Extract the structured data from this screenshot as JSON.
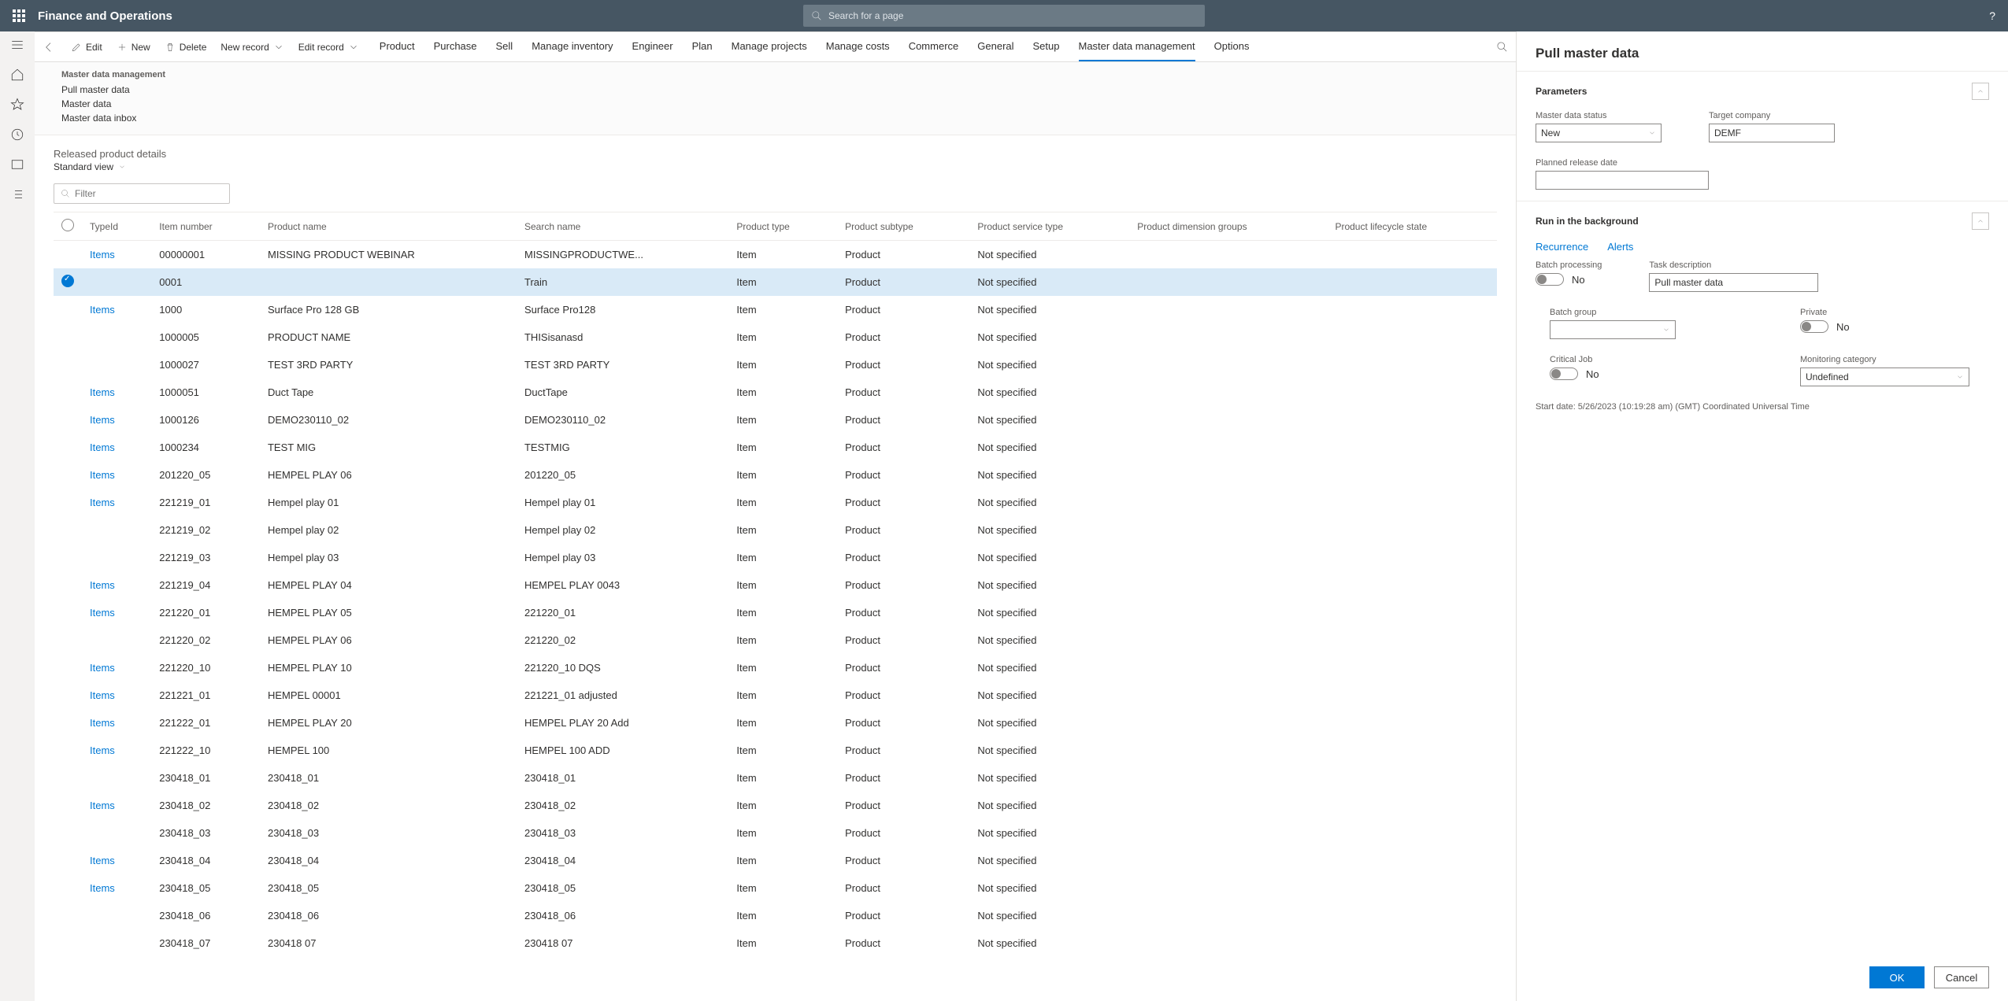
{
  "header": {
    "app_title": "Finance and Operations",
    "search_placeholder": "Search for a page"
  },
  "actionbar": {
    "edit": "Edit",
    "new": "New",
    "delete": "Delete",
    "new_record": "New record",
    "edit_record": "Edit record",
    "tabs": [
      "Product",
      "Purchase",
      "Sell",
      "Manage inventory",
      "Engineer",
      "Plan",
      "Manage projects",
      "Manage costs",
      "Commerce",
      "General",
      "Setup",
      "Master data management",
      "Options"
    ],
    "active_tab": 11
  },
  "secondary": {
    "heading": "Master data management",
    "links": [
      "Pull master data",
      "Master data",
      "Master data inbox"
    ]
  },
  "page": {
    "subtitle": "Released product details",
    "title": "Standard view",
    "filter_placeholder": "Filter"
  },
  "columns": [
    "TypeId",
    "Item number",
    "Product name",
    "Search name",
    "Product type",
    "Product subtype",
    "Product service type",
    "Product dimension groups",
    "Product lifecycle state"
  ],
  "rows": [
    {
      "typeid": "Items",
      "item": "00000001",
      "name": "MISSING PRODUCT WEBINAR",
      "search": "MISSINGPRODUCTWE...",
      "ptype": "Item",
      "sub": "Product",
      "svc": "Not specified",
      "sel": false
    },
    {
      "typeid": "",
      "item": "0001",
      "name": "",
      "search": "Train",
      "ptype": "Item",
      "sub": "Product",
      "svc": "Not specified",
      "sel": true
    },
    {
      "typeid": "Items",
      "item": "1000",
      "name": "Surface Pro 128 GB",
      "search": "Surface Pro128",
      "ptype": "Item",
      "sub": "Product",
      "svc": "Not specified",
      "sel": false
    },
    {
      "typeid": "",
      "item": "1000005",
      "name": "PRODUCT NAME",
      "search": "THISisanasd",
      "ptype": "Item",
      "sub": "Product",
      "svc": "Not specified",
      "sel": false
    },
    {
      "typeid": "",
      "item": "1000027",
      "name": "TEST 3RD PARTY",
      "search": "TEST 3RD PARTY",
      "ptype": "Item",
      "sub": "Product",
      "svc": "Not specified",
      "sel": false
    },
    {
      "typeid": "Items",
      "item": "1000051",
      "name": "Duct Tape",
      "search": "DuctTape",
      "ptype": "Item",
      "sub": "Product",
      "svc": "Not specified",
      "sel": false
    },
    {
      "typeid": "Items",
      "item": "1000126",
      "name": "DEMO230110_02",
      "search": "DEMO230110_02",
      "ptype": "Item",
      "sub": "Product",
      "svc": "Not specified",
      "sel": false
    },
    {
      "typeid": "Items",
      "item": "1000234",
      "name": "TEST MIG",
      "search": "TESTMIG",
      "ptype": "Item",
      "sub": "Product",
      "svc": "Not specified",
      "sel": false
    },
    {
      "typeid": "Items",
      "item": "201220_05",
      "name": "HEMPEL PLAY 06",
      "search": "201220_05",
      "ptype": "Item",
      "sub": "Product",
      "svc": "Not specified",
      "sel": false
    },
    {
      "typeid": "Items",
      "item": "221219_01",
      "name": "Hempel play 01",
      "search": "Hempel play 01",
      "ptype": "Item",
      "sub": "Product",
      "svc": "Not specified",
      "sel": false
    },
    {
      "typeid": "",
      "item": "221219_02",
      "name": "Hempel play 02",
      "search": "Hempel play 02",
      "ptype": "Item",
      "sub": "Product",
      "svc": "Not specified",
      "sel": false
    },
    {
      "typeid": "",
      "item": "221219_03",
      "name": "Hempel play 03",
      "search": "Hempel play 03",
      "ptype": "Item",
      "sub": "Product",
      "svc": "Not specified",
      "sel": false
    },
    {
      "typeid": "Items",
      "item": "221219_04",
      "name": "HEMPEL PLAY 04",
      "search": "HEMPEL PLAY 0043",
      "ptype": "Item",
      "sub": "Product",
      "svc": "Not specified",
      "sel": false
    },
    {
      "typeid": "Items",
      "item": "221220_01",
      "name": "HEMPEL PLAY 05",
      "search": "221220_01",
      "ptype": "Item",
      "sub": "Product",
      "svc": "Not specified",
      "sel": false
    },
    {
      "typeid": "",
      "item": "221220_02",
      "name": "HEMPEL PLAY 06",
      "search": "221220_02",
      "ptype": "Item",
      "sub": "Product",
      "svc": "Not specified",
      "sel": false
    },
    {
      "typeid": "Items",
      "item": "221220_10",
      "name": "HEMPEL PLAY 10",
      "search": "221220_10 DQS",
      "ptype": "Item",
      "sub": "Product",
      "svc": "Not specified",
      "sel": false
    },
    {
      "typeid": "Items",
      "item": "221221_01",
      "name": "HEMPEL 00001",
      "search": "221221_01 adjusted",
      "ptype": "Item",
      "sub": "Product",
      "svc": "Not specified",
      "sel": false
    },
    {
      "typeid": "Items",
      "item": "221222_01",
      "name": "HEMPEL PLAY 20",
      "search": "HEMPEL PLAY 20 Add",
      "ptype": "Item",
      "sub": "Product",
      "svc": "Not specified",
      "sel": false
    },
    {
      "typeid": "Items",
      "item": "221222_10",
      "name": "HEMPEL 100",
      "search": "HEMPEL 100 ADD",
      "ptype": "Item",
      "sub": "Product",
      "svc": "Not specified",
      "sel": false
    },
    {
      "typeid": "",
      "item": "230418_01",
      "name": "230418_01",
      "search": "230418_01",
      "ptype": "Item",
      "sub": "Product",
      "svc": "Not specified",
      "sel": false
    },
    {
      "typeid": "Items",
      "item": "230418_02",
      "name": "230418_02",
      "search": "230418_02",
      "ptype": "Item",
      "sub": "Product",
      "svc": "Not specified",
      "sel": false
    },
    {
      "typeid": "",
      "item": "230418_03",
      "name": "230418_03",
      "search": "230418_03",
      "ptype": "Item",
      "sub": "Product",
      "svc": "Not specified",
      "sel": false
    },
    {
      "typeid": "Items",
      "item": "230418_04",
      "name": "230418_04",
      "search": "230418_04",
      "ptype": "Item",
      "sub": "Product",
      "svc": "Not specified",
      "sel": false
    },
    {
      "typeid": "Items",
      "item": "230418_05",
      "name": "230418_05",
      "search": "230418_05",
      "ptype": "Item",
      "sub": "Product",
      "svc": "Not specified",
      "sel": false
    },
    {
      "typeid": "",
      "item": "230418_06",
      "name": "230418_06",
      "search": "230418_06",
      "ptype": "Item",
      "sub": "Product",
      "svc": "Not specified",
      "sel": false
    },
    {
      "typeid": "",
      "item": "230418_07",
      "name": "230418 07",
      "search": "230418 07",
      "ptype": "Item",
      "sub": "Product",
      "svc": "Not specified",
      "sel": false
    }
  ],
  "panel": {
    "title": "Pull master data",
    "parameters_heading": "Parameters",
    "fields": {
      "master_data_status_label": "Master data status",
      "master_data_status_value": "New",
      "target_company_label": "Target company",
      "target_company_value": "DEMF",
      "planned_release_label": "Planned release date",
      "planned_release_value": ""
    },
    "run_heading": "Run in the background",
    "recurrence": "Recurrence",
    "alerts": "Alerts",
    "batch_processing_label": "Batch processing",
    "batch_processing_value": "No",
    "task_description_label": "Task description",
    "task_description_value": "Pull master data",
    "batch_group_label": "Batch group",
    "batch_group_value": "",
    "private_label": "Private",
    "private_value": "No",
    "critical_label": "Critical Job",
    "critical_value": "No",
    "monitoring_label": "Monitoring category",
    "monitoring_value": "Undefined",
    "start_date": "Start date: 5/26/2023 (10:19:28 am) (GMT) Coordinated Universal Time",
    "ok": "OK",
    "cancel": "Cancel"
  }
}
